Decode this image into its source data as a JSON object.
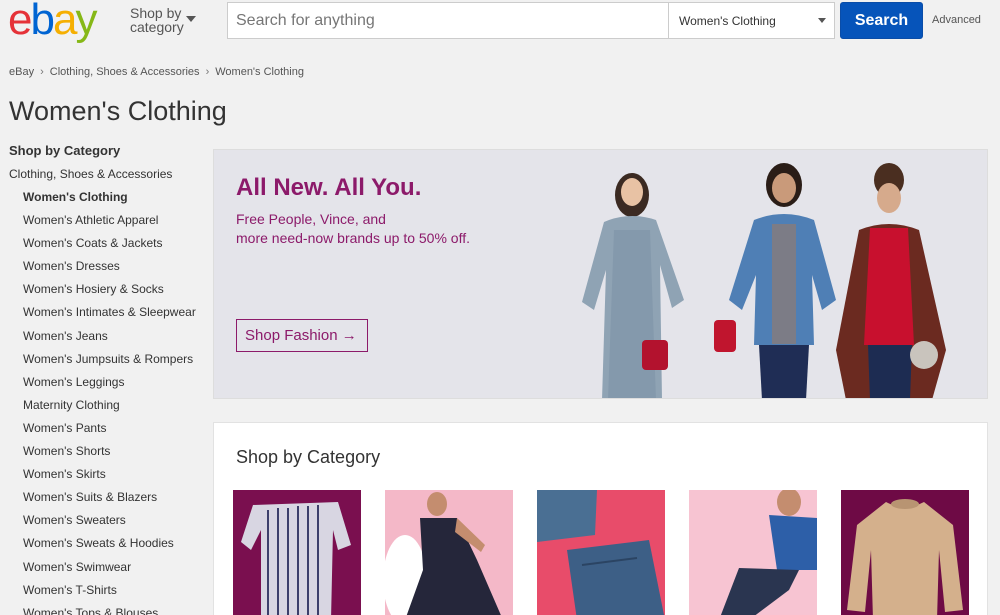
{
  "header": {
    "logo": {
      "e": "e",
      "b": "b",
      "a": "a",
      "y": "y"
    },
    "shop_by": "Shop by",
    "category_word": "category",
    "search_placeholder": "Search for anything",
    "category_selected": "Women's Clothing",
    "search_button": "Search",
    "advanced": "Advanced"
  },
  "breadcrumb": [
    "eBay",
    "Clothing, Shoes & Accessories",
    "Women's Clothing"
  ],
  "page_title": "Women's Clothing",
  "sidebar": {
    "heading": "Shop by Category",
    "parent": "Clothing, Shoes & Accessories",
    "items": [
      {
        "label": "Women's Clothing",
        "active": true
      },
      {
        "label": "Women's Athletic Apparel"
      },
      {
        "label": "Women's Coats & Jackets"
      },
      {
        "label": "Women's Dresses"
      },
      {
        "label": "Women's Hosiery & Socks"
      },
      {
        "label": "Women's Intimates & Sleepwear"
      },
      {
        "label": "Women's Jeans"
      },
      {
        "label": "Women's Jumpsuits & Rompers"
      },
      {
        "label": "Women's Leggings"
      },
      {
        "label": "Maternity Clothing"
      },
      {
        "label": "Women's Pants"
      },
      {
        "label": "Women's Shorts"
      },
      {
        "label": "Women's Skirts"
      },
      {
        "label": "Women's Suits & Blazers"
      },
      {
        "label": "Women's Sweaters"
      },
      {
        "label": "Women's Sweats & Hoodies"
      },
      {
        "label": "Women's Swimwear"
      },
      {
        "label": "Women's T-Shirts"
      },
      {
        "label": "Women's Tops & Blouses"
      }
    ]
  },
  "banner": {
    "title": "All New. All You.",
    "subtitle_line1": "Free People, Vince, and",
    "subtitle_line2": "more need-now brands up to 50% off.",
    "button": "Shop Fashion",
    "button_arrow": "→",
    "accent_color": "#8c1a6a"
  },
  "category_section": {
    "title": "Shop by Category",
    "tiles": [
      {
        "name": "striped-top-tile",
        "bg": "#7a0f4f"
      },
      {
        "name": "dress-tile",
        "bg": "#f4b8c8"
      },
      {
        "name": "jeans-tile",
        "bg": "#e84c6a"
      },
      {
        "name": "athletic-tile",
        "bg": "#f7c4d2"
      },
      {
        "name": "sweater-tile",
        "bg": "#6e0a45"
      }
    ]
  }
}
